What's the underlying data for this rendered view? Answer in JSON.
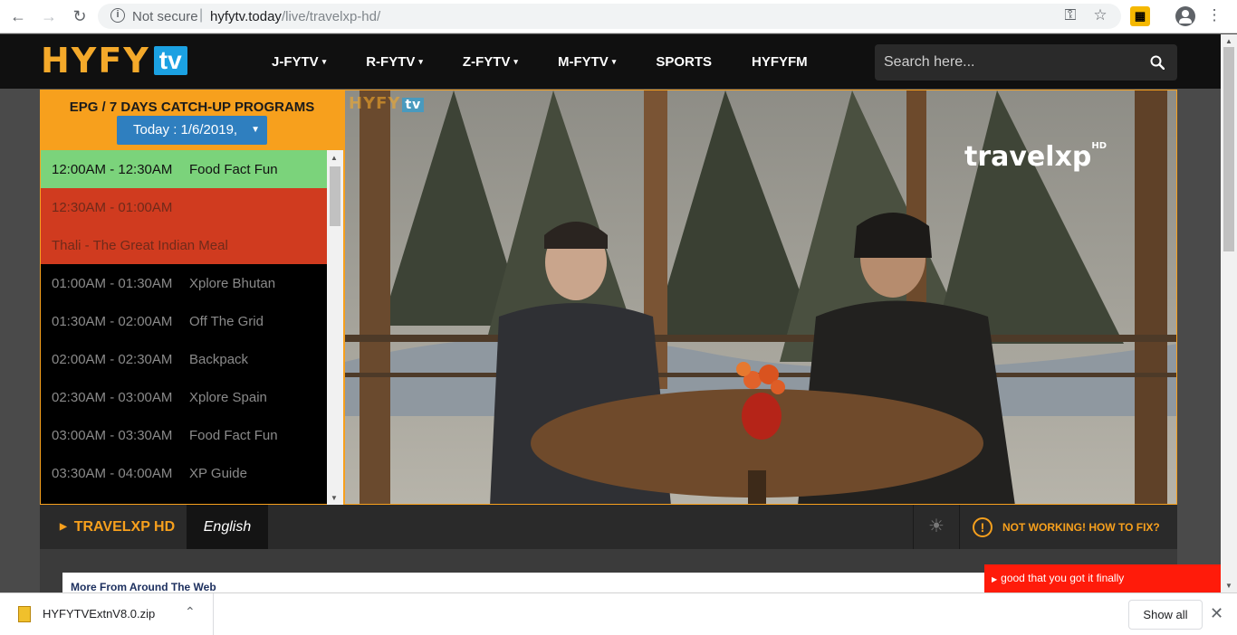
{
  "browser": {
    "secure_label": "Not secure",
    "separator": "|",
    "url_host": "hyfytv.today",
    "url_path": "/live/travelxp-hd/"
  },
  "site": {
    "logo_text": "HYFY",
    "logo_tv": "tv",
    "nav": [
      {
        "label": "J-FYTV",
        "caret": "▾"
      },
      {
        "label": "R-FYTV",
        "caret": "▾"
      },
      {
        "label": "Z-FYTV",
        "caret": "▾"
      },
      {
        "label": "M-FYTV",
        "caret": "▾"
      },
      {
        "label": "SPORTS",
        "caret": ""
      },
      {
        "label": "HYFYFM",
        "caret": ""
      }
    ],
    "search_placeholder": "Search here..."
  },
  "epg": {
    "title": "EPG / 7 DAYS CATCH-UP PROGRAMS",
    "date": "Today : 1/6/2019,",
    "programs": [
      {
        "time": "12:00AM - 12:30AM",
        "name": "Food Fact Fun",
        "state": "active"
      },
      {
        "time": "12:30AM - 01:00AM",
        "name": "",
        "state": "current"
      },
      {
        "time": "Thali - The Great Indian Meal",
        "name": "",
        "state": "current"
      },
      {
        "time": "01:00AM - 01:30AM",
        "name": "Xplore Bhutan",
        "state": ""
      },
      {
        "time": "01:30AM - 02:00AM",
        "name": "Off The Grid",
        "state": ""
      },
      {
        "time": "02:00AM - 02:30AM",
        "name": "Backpack",
        "state": ""
      },
      {
        "time": "02:30AM - 03:00AM",
        "name": "Xplore Spain",
        "state": ""
      },
      {
        "time": "03:00AM - 03:30AM",
        "name": "Food Fact Fun",
        "state": ""
      },
      {
        "time": "03:30AM - 04:00AM",
        "name": "XP Guide",
        "state": ""
      }
    ]
  },
  "video": {
    "watermark_logo": "HYFY",
    "watermark_tv": "tv",
    "channel_logo": "travelxp",
    "channel_logo_sup": "HD"
  },
  "player_bar": {
    "channel": "TRAVELXP HD",
    "language": "English",
    "fix_label": "NOT WORKING! HOW TO FIX?"
  },
  "more": {
    "title": "More From Around The Web"
  },
  "toast": {
    "text": "good that you got it finally"
  },
  "downloads": {
    "file": "HYFYTVExtnV8.0.zip",
    "show_all": "Show all"
  },
  "colors": {
    "accent": "#f7a01d",
    "active_row": "#7bd37b",
    "current_row": "#d03b1f",
    "date_button": "#2f7fbf",
    "toast": "#ff1b0a"
  }
}
